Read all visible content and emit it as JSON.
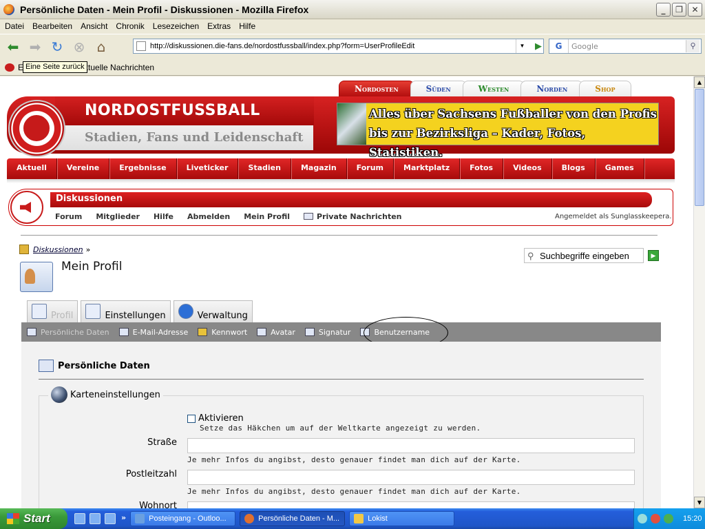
{
  "window": {
    "title": "Persönliche Daten - Mein Profil - Diskussionen - Mozilla Firefox",
    "minimize": "_",
    "maximize": "❐",
    "close": "✕"
  },
  "menu": [
    "Datei",
    "Bearbeiten",
    "Ansicht",
    "Chronik",
    "Lesezeichen",
    "Extras",
    "Hilfe"
  ],
  "navigation": {
    "url": "http://diskussionen.die-fans.de/nordostfussball/index.php?form=UserProfileEdit",
    "search_placeholder": "Google",
    "search_engine_letter": "G"
  },
  "bookmarks": {
    "first": "E",
    "second": "Aktuelle Nachrichten"
  },
  "tooltip": "Eine Seite zurück",
  "site": {
    "region_tabs": [
      "Nordosten",
      "Süden",
      "Westen",
      "Norden",
      "Shop"
    ],
    "active_region": "Nordosten",
    "name": "NORDOSTFUSSBALL",
    "slogan": "Stadien, Fans und Leidenschaft",
    "ad_line1": "Alles über Sachsens Fußballer von den Profis",
    "ad_line2": "bis zur Bezirksliga – Kader, Fotos, Statistiken.",
    "main_nav": [
      "Aktuell",
      "Vereine",
      "Ergebnisse",
      "Liveticker",
      "Stadien",
      "Magazin",
      "Forum",
      "Marktplatz",
      "Fotos",
      "Videos",
      "Blogs",
      "Games"
    ]
  },
  "forum": {
    "title": "Diskussionen",
    "links": [
      "Forum",
      "Mitglieder",
      "Hilfe",
      "Abmelden",
      "Mein Profil",
      "Private Nachrichten"
    ],
    "logged_in": "Angemeldet als Sunglasskeepera."
  },
  "page": {
    "breadcrumb": "Diskussionen",
    "breadcrumb_sep": "»",
    "title": "Mein Profil",
    "search_button": "Suchbegriffe eingeben",
    "tabs": [
      "Profil",
      "Einstellungen",
      "Verwaltung"
    ],
    "subtabs": [
      "Persönliche Daten",
      "E-Mail-Adresse",
      "Kennwort",
      "Avatar",
      "Signatur",
      "Benutzername"
    ],
    "section_title": "Persönliche Daten",
    "fieldset_legend": "Karteneinstellungen",
    "checkbox_label": "Aktivieren",
    "checkbox_hint": "Setze das Häkchen um auf der Weltkarte angezeigt zu werden.",
    "fields": [
      {
        "label": "Straße",
        "value": "",
        "hint": "Je mehr Infos du angibst, desto genauer findet man dich auf der Karte."
      },
      {
        "label": "Postleitzahl",
        "value": "",
        "hint": "Je mehr Infos du angibst, desto genauer findet man dich auf der Karte."
      },
      {
        "label": "Wohnort",
        "value": ""
      }
    ]
  },
  "taskbar": {
    "start": "Start",
    "more": "»",
    "items": [
      "Posteingang - Outloo...",
      "Persönliche Daten - M...",
      "Lokist"
    ],
    "clock": "15:20"
  }
}
